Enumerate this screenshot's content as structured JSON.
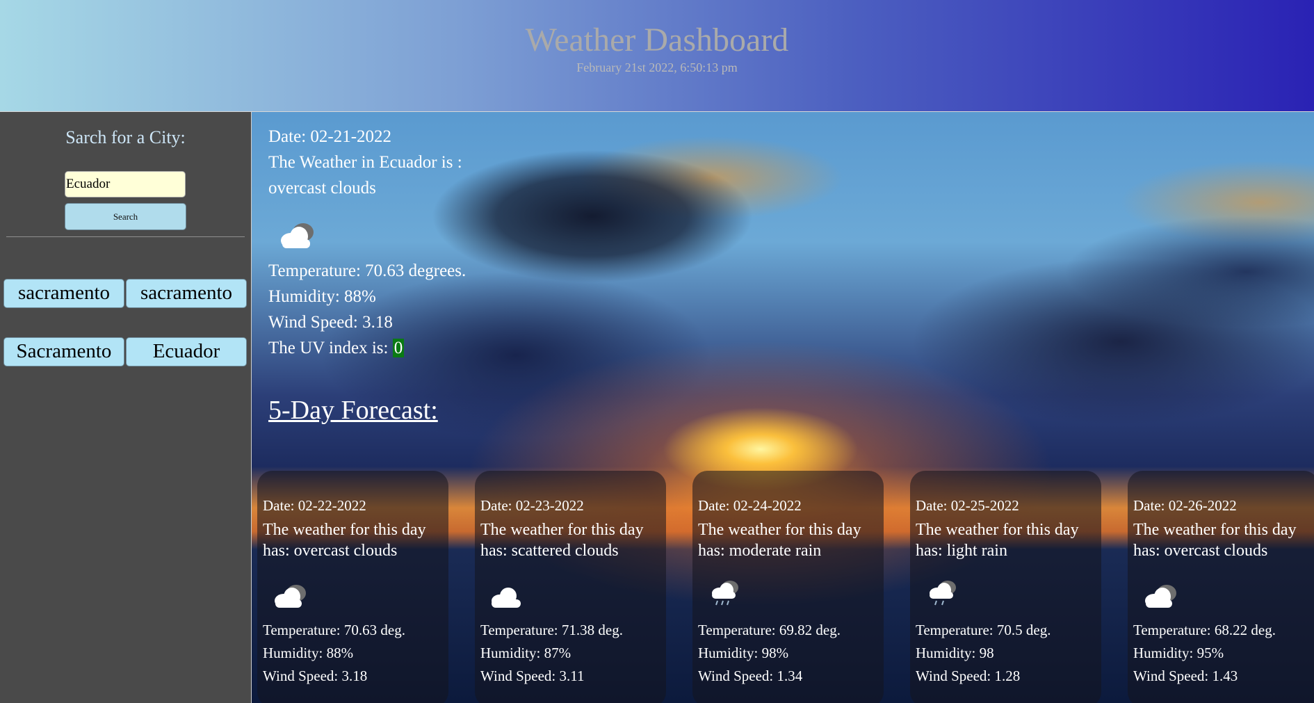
{
  "header": {
    "title": "Weather Dashboard",
    "timestamp": "February 21st 2022, 6:50:13 pm"
  },
  "sidebar": {
    "search_label": "Sarch for a City:",
    "search_value": "Ecuador",
    "search_button": "Search",
    "history": [
      "sacramento",
      "sacramento",
      "Sacramento",
      "Ecuador"
    ]
  },
  "current": {
    "date": "Date: 02-21-2022",
    "weather_line": "The Weather in Ecuador is :",
    "description": "overcast clouds",
    "icon": "cloud-icon",
    "temperature": "Temperature: 70.63 degrees.",
    "humidity": "Humidity: 88%",
    "wind": "Wind Speed: 3.18",
    "uv_label": "The UV index is: ",
    "uv_value": "0",
    "uv_color": "#0a7a14"
  },
  "forecast": {
    "heading": "5-Day Forecast:",
    "days": [
      {
        "date": "Date: 02-22-2022",
        "desc": "The weather for this day has: overcast clouds",
        "icon": "cloud-icon",
        "temp": "Temperature: 70.63 deg.",
        "humidity": "Humidity: 88%",
        "wind": "Wind Speed: 3.18"
      },
      {
        "date": "Date: 02-23-2022",
        "desc": "The weather for this day has: scattered clouds",
        "icon": "cloud-icon",
        "temp": "Temperature: 71.38 deg.",
        "humidity": "Humidity: 87%",
        "wind": "Wind Speed: 3.11"
      },
      {
        "date": "Date: 02-24-2022",
        "desc": "The weather for this day has: moderate rain",
        "icon": "rain-cloud-icon",
        "temp": "Temperature: 69.82 deg.",
        "humidity": "Humidity: 98%",
        "wind": "Wind Speed: 1.34"
      },
      {
        "date": "Date: 02-25-2022",
        "desc": "The weather for this day has: light rain",
        "icon": "rain-cloud-icon",
        "temp": "Temperature: 70.5 deg.",
        "humidity": "Humidity: 98",
        "wind": "Wind Speed: 1.28"
      },
      {
        "date": "Date: 02-26-2022",
        "desc": "The weather for this day has: overcast clouds",
        "icon": "cloud-icon",
        "temp": "Temperature: 68.22 deg.",
        "humidity": "Humidity: 95%",
        "wind": "Wind Speed: 1.43"
      }
    ]
  }
}
